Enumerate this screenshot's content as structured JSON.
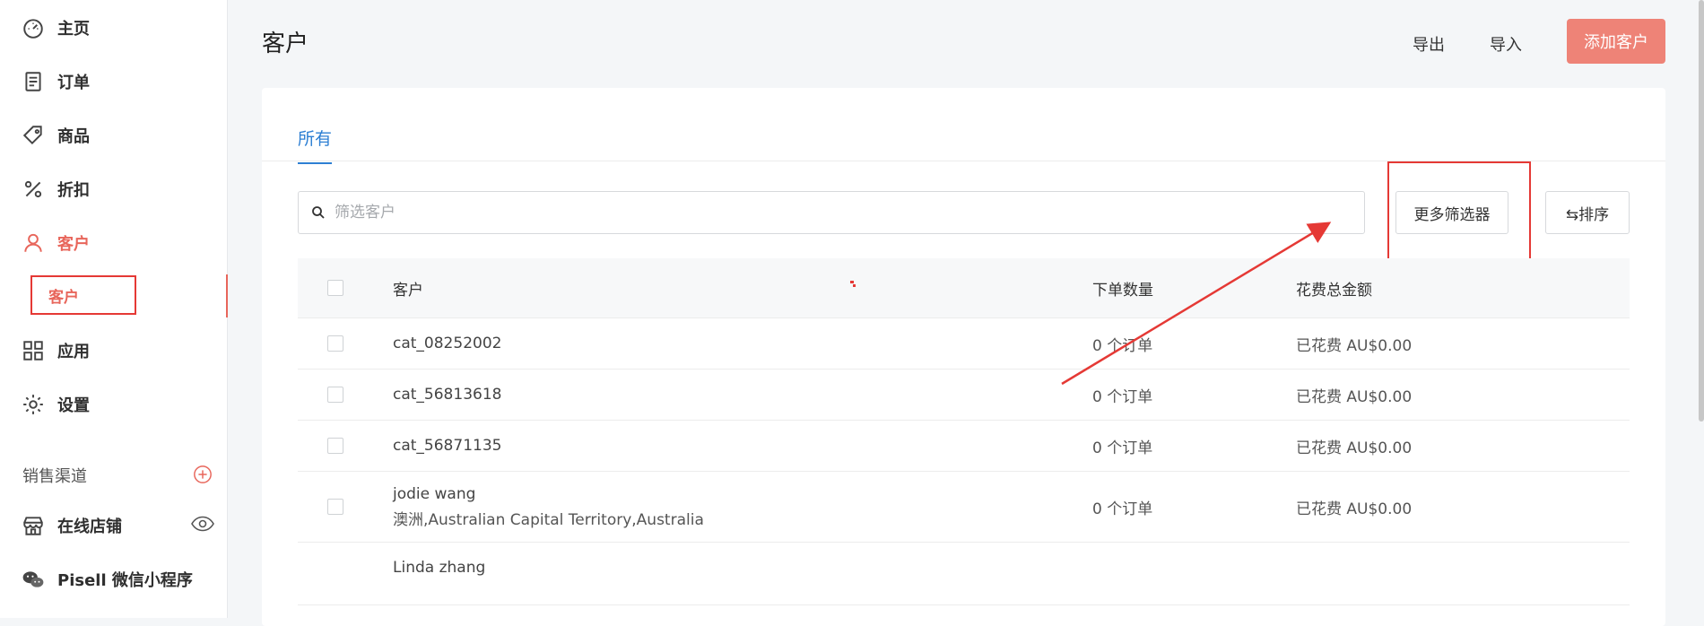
{
  "sidebar": {
    "items": [
      {
        "label": "主页",
        "icon": "dashboard-icon"
      },
      {
        "label": "订单",
        "icon": "order-icon"
      },
      {
        "label": "商品",
        "icon": "tag-icon"
      },
      {
        "label": "折扣",
        "icon": "percent-icon"
      },
      {
        "label": "客户",
        "icon": "user-icon"
      },
      {
        "label": "应用",
        "icon": "apps-icon"
      },
      {
        "label": "设置",
        "icon": "gear-icon"
      }
    ],
    "sub_item": "客户",
    "channels_title": "销售渠道",
    "channels": [
      {
        "label": "在线店铺",
        "icon": "store-icon"
      },
      {
        "label": "Pisell 微信小程序",
        "icon": "wechat-icon"
      }
    ]
  },
  "header": {
    "title": "客户",
    "export_label": "导出",
    "import_label": "导入",
    "add_label": "添加客户"
  },
  "tabs": {
    "all": "所有"
  },
  "search": {
    "placeholder": "筛选客户"
  },
  "filters": {
    "more_label": "更多筛选器",
    "sort_label": "⇆排序"
  },
  "table": {
    "headers": {
      "customer": "客户",
      "orders": "下单数量",
      "spent": "花费总金额"
    },
    "rows": [
      {
        "name": "cat_08252002",
        "address": "",
        "orders": "0 个订单",
        "spent": "已花费 AU$0.00"
      },
      {
        "name": "cat_56813618",
        "address": "",
        "orders": "0 个订单",
        "spent": "已花费 AU$0.00"
      },
      {
        "name": "cat_56871135",
        "address": "",
        "orders": "0 个订单",
        "spent": "已花费 AU$0.00"
      },
      {
        "name": "jodie wang",
        "address": "澳洲,Australian Capital Territory,Australia",
        "orders": "0 个订单",
        "spent": "已花费 AU$0.00"
      },
      {
        "name": "Linda zhang",
        "address": "",
        "orders": "",
        "spent": ""
      }
    ]
  },
  "colors": {
    "accent": "#e8665b",
    "primary_button": "#ee8377",
    "tab_active": "#2d7fd3",
    "annotation": "#e53935"
  }
}
